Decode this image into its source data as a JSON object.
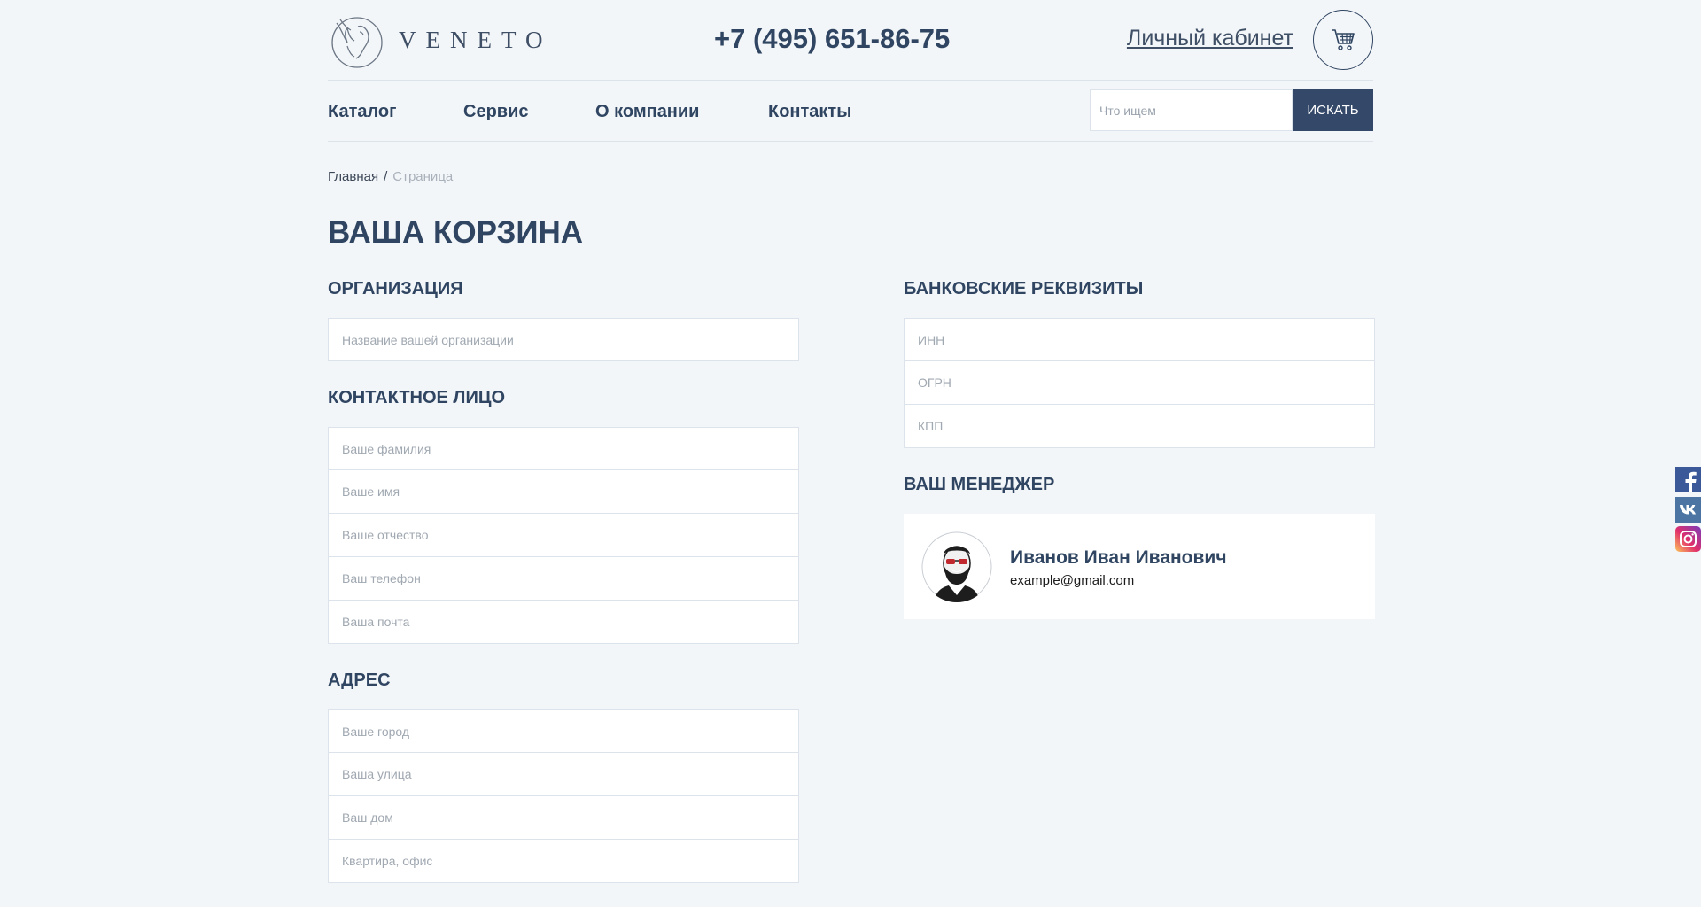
{
  "header": {
    "logo_text": "VENETO",
    "phone": "+7 (495) 651-86-75",
    "account_link": "Личный кабинет",
    "cart_icon": "cart-icon"
  },
  "nav": {
    "items": [
      "Каталог",
      "Сервис",
      "О компании",
      "Контакты"
    ],
    "search_placeholder": "Что ищем",
    "search_button": "ИСКАТЬ"
  },
  "breadcrumb": {
    "home": "Главная",
    "separator": "/",
    "current": "Страница"
  },
  "page_title": "ВАША КОРЗИНА",
  "organization": {
    "title": "ОРГАНИЗАЦИЯ",
    "fields": [
      "Название вашей организации"
    ]
  },
  "contact": {
    "title": "КОНТАКТНОЕ ЛИЦО",
    "fields": [
      "Ваше фамилия",
      "Ваше имя",
      "Ваше отчество",
      "Ваш телефон",
      "Ваша почта"
    ]
  },
  "address": {
    "title": "АДРЕС",
    "fields": [
      "Ваше город",
      "Ваша улица",
      "Ваш дом",
      "Квартира, офис"
    ]
  },
  "bank": {
    "title": "БАНКОВСКИЕ РЕКВИЗИТЫ",
    "fields": [
      "ИНН",
      "ОГРН",
      "КПП"
    ]
  },
  "manager": {
    "title": "ВАШ МЕНЕДЖЕР",
    "name": "Иванов Иван Иванович",
    "email": "example@gmail.com"
  },
  "social": {
    "icons": [
      "facebook-icon",
      "vk-icon",
      "instagram-icon"
    ]
  },
  "colors": {
    "background": "#f3f6f9",
    "primary": "#2f4561",
    "button": "#34496a",
    "border": "#dde3ea"
  }
}
